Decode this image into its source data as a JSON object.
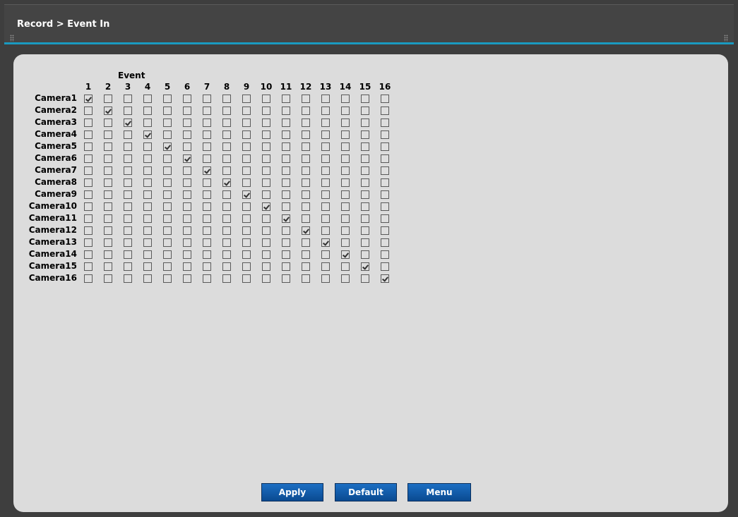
{
  "title": "Record > Event In",
  "grid": {
    "event_title": "Event",
    "columns": [
      "1",
      "2",
      "3",
      "4",
      "5",
      "6",
      "7",
      "8",
      "9",
      "10",
      "11",
      "12",
      "13",
      "14",
      "15",
      "16"
    ],
    "rows": [
      {
        "label": "Camera1",
        "checked": [
          1,
          0,
          0,
          0,
          0,
          0,
          0,
          0,
          0,
          0,
          0,
          0,
          0,
          0,
          0,
          0
        ]
      },
      {
        "label": "Camera2",
        "checked": [
          0,
          1,
          0,
          0,
          0,
          0,
          0,
          0,
          0,
          0,
          0,
          0,
          0,
          0,
          0,
          0
        ]
      },
      {
        "label": "Camera3",
        "checked": [
          0,
          0,
          1,
          0,
          0,
          0,
          0,
          0,
          0,
          0,
          0,
          0,
          0,
          0,
          0,
          0
        ]
      },
      {
        "label": "Camera4",
        "checked": [
          0,
          0,
          0,
          1,
          0,
          0,
          0,
          0,
          0,
          0,
          0,
          0,
          0,
          0,
          0,
          0
        ]
      },
      {
        "label": "Camera5",
        "checked": [
          0,
          0,
          0,
          0,
          1,
          0,
          0,
          0,
          0,
          0,
          0,
          0,
          0,
          0,
          0,
          0
        ]
      },
      {
        "label": "Camera6",
        "checked": [
          0,
          0,
          0,
          0,
          0,
          1,
          0,
          0,
          0,
          0,
          0,
          0,
          0,
          0,
          0,
          0
        ]
      },
      {
        "label": "Camera7",
        "checked": [
          0,
          0,
          0,
          0,
          0,
          0,
          1,
          0,
          0,
          0,
          0,
          0,
          0,
          0,
          0,
          0
        ]
      },
      {
        "label": "Camera8",
        "checked": [
          0,
          0,
          0,
          0,
          0,
          0,
          0,
          1,
          0,
          0,
          0,
          0,
          0,
          0,
          0,
          0
        ]
      },
      {
        "label": "Camera9",
        "checked": [
          0,
          0,
          0,
          0,
          0,
          0,
          0,
          0,
          1,
          0,
          0,
          0,
          0,
          0,
          0,
          0
        ]
      },
      {
        "label": "Camera10",
        "checked": [
          0,
          0,
          0,
          0,
          0,
          0,
          0,
          0,
          0,
          1,
          0,
          0,
          0,
          0,
          0,
          0
        ]
      },
      {
        "label": "Camera11",
        "checked": [
          0,
          0,
          0,
          0,
          0,
          0,
          0,
          0,
          0,
          0,
          1,
          0,
          0,
          0,
          0,
          0
        ]
      },
      {
        "label": "Camera12",
        "checked": [
          0,
          0,
          0,
          0,
          0,
          0,
          0,
          0,
          0,
          0,
          0,
          1,
          0,
          0,
          0,
          0
        ]
      },
      {
        "label": "Camera13",
        "checked": [
          0,
          0,
          0,
          0,
          0,
          0,
          0,
          0,
          0,
          0,
          0,
          0,
          1,
          0,
          0,
          0
        ]
      },
      {
        "label": "Camera14",
        "checked": [
          0,
          0,
          0,
          0,
          0,
          0,
          0,
          0,
          0,
          0,
          0,
          0,
          0,
          1,
          0,
          0
        ]
      },
      {
        "label": "Camera15",
        "checked": [
          0,
          0,
          0,
          0,
          0,
          0,
          0,
          0,
          0,
          0,
          0,
          0,
          0,
          0,
          1,
          0
        ]
      },
      {
        "label": "Camera16",
        "checked": [
          0,
          0,
          0,
          0,
          0,
          0,
          0,
          0,
          0,
          0,
          0,
          0,
          0,
          0,
          0,
          1
        ]
      }
    ]
  },
  "buttons": {
    "apply": "Apply",
    "default": "Default",
    "menu": "Menu"
  },
  "colors": {
    "accent": "#1a9ac0",
    "button": "#0a4a91",
    "panel": "#dcdcdc"
  }
}
